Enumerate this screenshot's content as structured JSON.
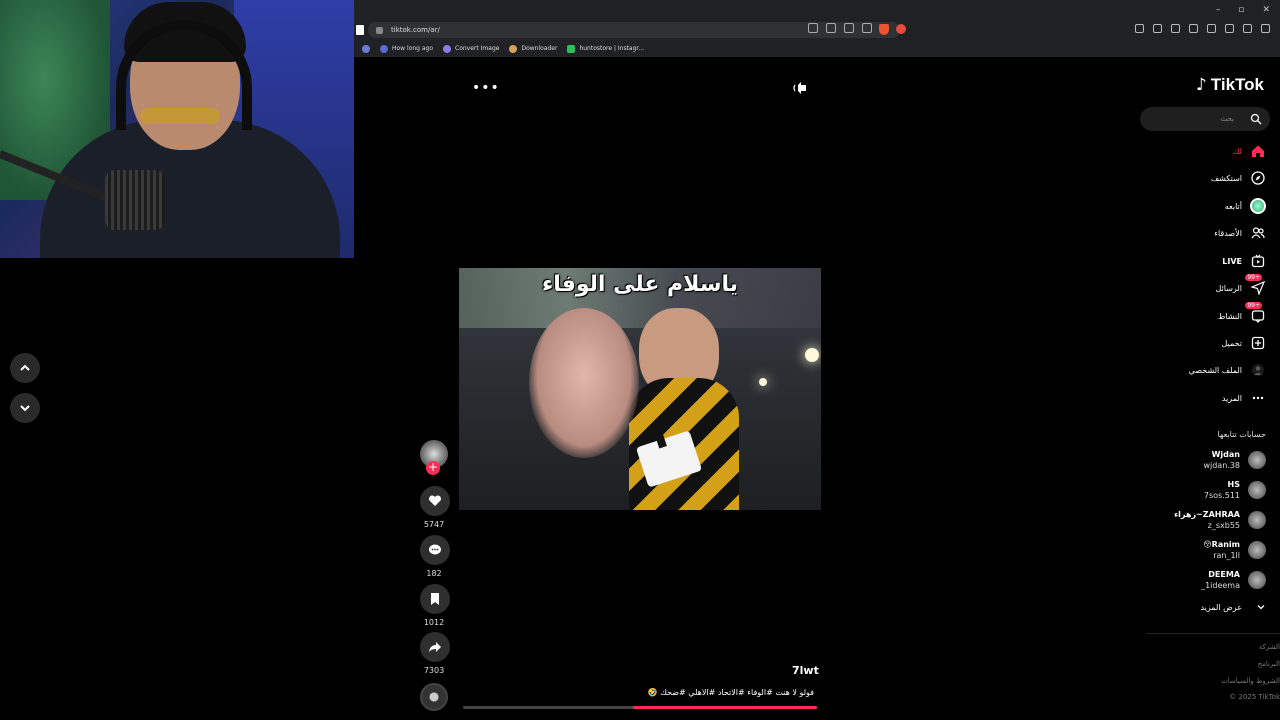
{
  "browser": {
    "url": "tiktok.com/ar/",
    "bookmarks": [
      "How long ago",
      "Convert Image",
      "Downloader",
      "huntostore | Instagr..."
    ]
  },
  "video": {
    "caption": "ياسلام على الوفاء",
    "author": "7lwt",
    "description": "فولو لا هنت #الوفاء #الاتحاد #الاهلي #ضحك 🤣",
    "progress_percent": 52,
    "likes": "5747",
    "comments": "182",
    "saves": "1012",
    "shares": "7303"
  },
  "sidebar": {
    "logo": "TikTok",
    "search_placeholder": "بحث",
    "nav": {
      "foryou": "لك",
      "explore": "استكشف",
      "following": "أتابعه",
      "friends": "الأصدقاء",
      "live": "LIVE",
      "messages": "الرسائل",
      "messages_badge": "99+",
      "activity": "النشاط",
      "activity_badge": "99+",
      "upload": "تحميل",
      "profile": "الملف الشخصي",
      "more": "المزيد"
    },
    "following_title": "حسابات تتابعها",
    "accounts": [
      {
        "display": "Wjdan",
        "handle": "wjdan.38"
      },
      {
        "display": "HS",
        "handle": "7sos.511"
      },
      {
        "display": "ZAHRAA~زهراء",
        "handle": "z_sxb55"
      },
      {
        "display": "Ranim😚",
        "handle": "ran_1ll"
      },
      {
        "display": "DEEMA",
        "handle": "_1ideema"
      }
    ],
    "see_more": "عرض المزيد",
    "footer": [
      "الشركة",
      "البرنامج",
      "الشروط والسياسات"
    ],
    "copyright": "© 2025 TikTok"
  },
  "colors": {
    "accent": "#fe2c55",
    "background": "#000000"
  }
}
